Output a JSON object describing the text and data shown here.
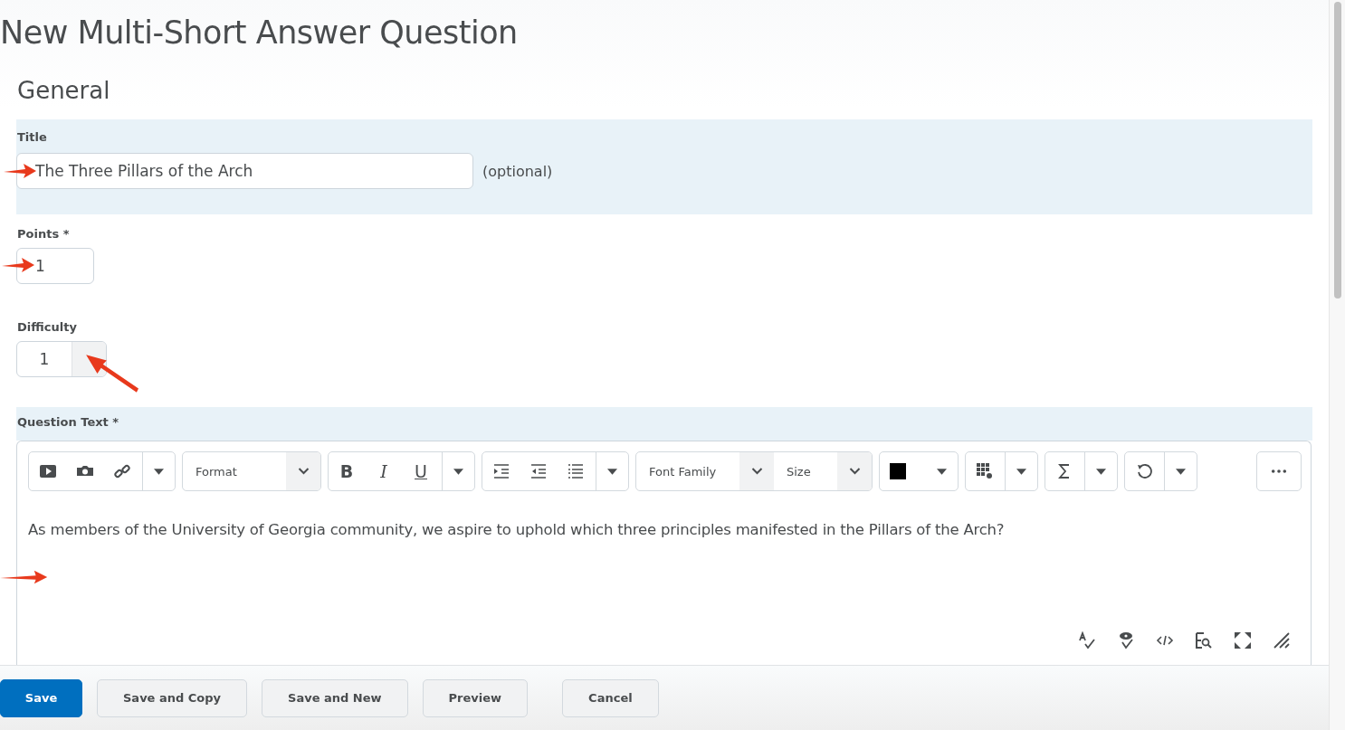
{
  "page_title": "New Multi-Short Answer Question",
  "section_title": "General",
  "title_field": {
    "label": "Title",
    "value": "The Three Pillars of the Arch",
    "note": "(optional)"
  },
  "points_field": {
    "label": "Points *",
    "value": "1"
  },
  "difficulty_field": {
    "label": "Difficulty",
    "value": "1"
  },
  "question_text": {
    "label": "Question Text *",
    "style_buttons": [
      {
        "glyph": "B",
        "kind": "bold"
      },
      {
        "glyph": "I",
        "kind": "italic"
      },
      {
        "glyph": "U",
        "kind": "underline"
      }
    ],
    "format_select": "Format",
    "font_family_select": "Font Family",
    "size_select": "Size",
    "text": "As members of the University of Georgia community, we aspire to uphold which three principles manifested in the Pillars of the Arch?"
  },
  "buttons": [
    {
      "label": "Save",
      "kind": "primary"
    },
    {
      "label": "Save and Copy",
      "kind": "secondary"
    },
    {
      "label": "Save and New",
      "kind": "secondary"
    },
    {
      "label": "Preview",
      "kind": "secondary"
    },
    {
      "label": "Cancel",
      "kind": "secondary"
    }
  ]
}
